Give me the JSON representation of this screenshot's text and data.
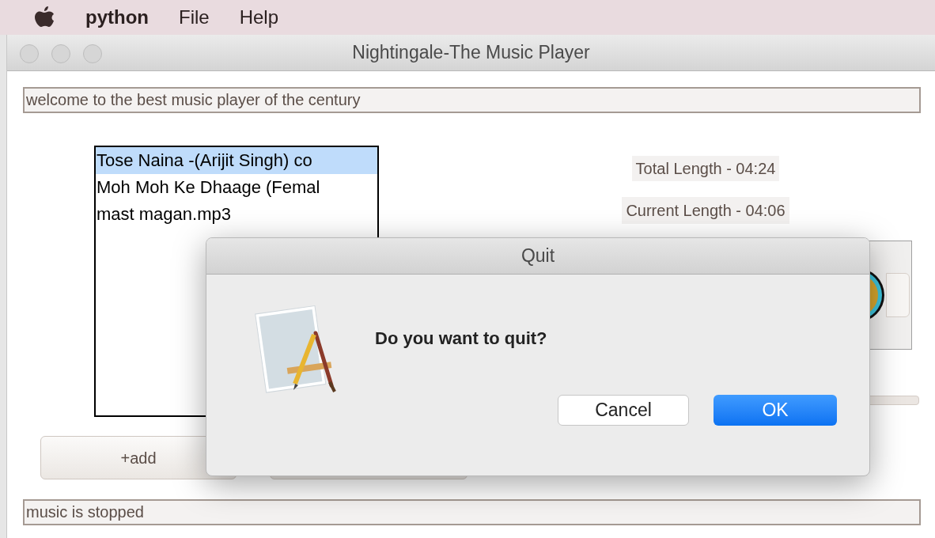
{
  "menu_bar": {
    "app_name": "python",
    "items": [
      "File",
      "Help"
    ]
  },
  "window": {
    "title": "Nightingale-The Music Player"
  },
  "header_label": "welcome to the best music player of the century",
  "playlist": [
    {
      "name": "Tose Naina -(Arijit Singh) co",
      "selected": true
    },
    {
      "name": "Moh Moh Ke Dhaage (Femal",
      "selected": false
    },
    {
      "name": "mast magan.mp3",
      "selected": false
    }
  ],
  "total_length": "Total Length - 04:24",
  "current_length": "Current Length - 04:06",
  "add_button": "+add",
  "status_label": "music is stopped",
  "dialog": {
    "title": "Quit",
    "message": "Do you want to quit?",
    "buttons": [
      {
        "label": "Cancel",
        "kind": "secondary"
      },
      {
        "label": "OK",
        "kind": "default"
      }
    ]
  }
}
